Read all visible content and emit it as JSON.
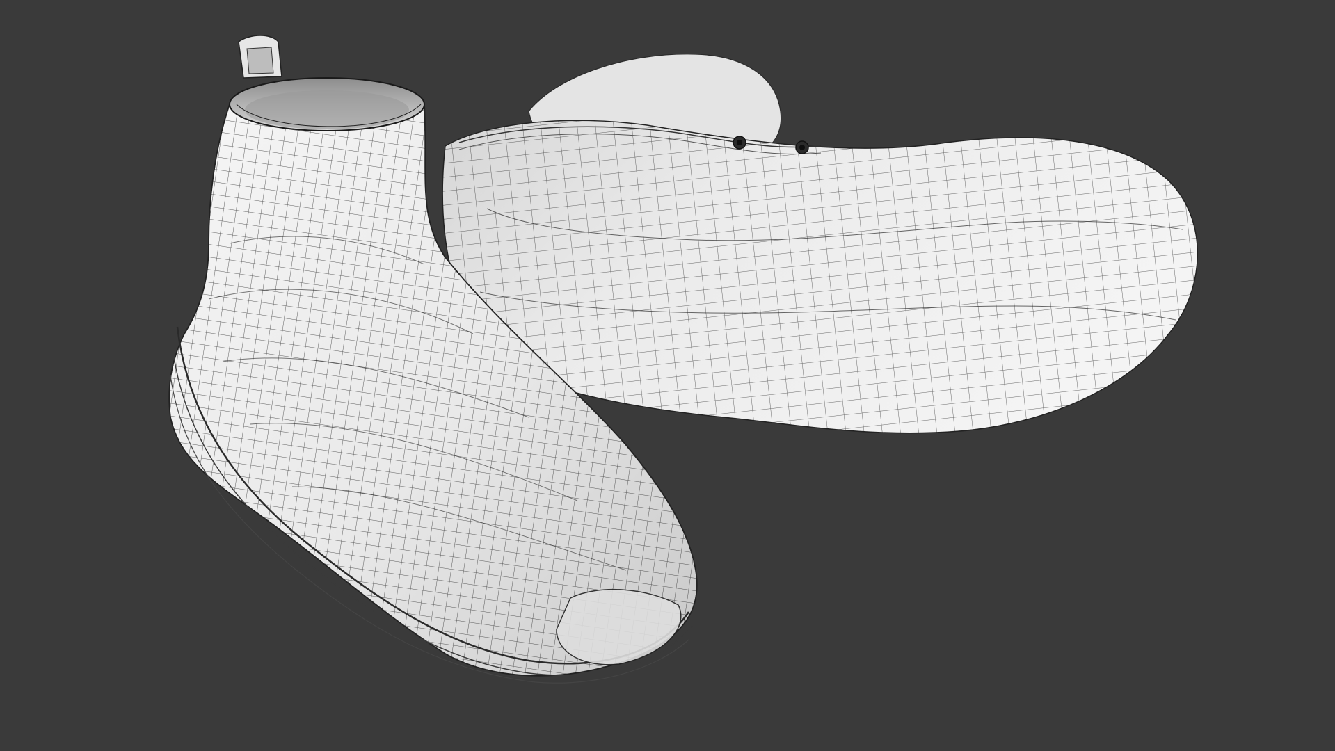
{
  "scene": {
    "background_color": "#3a3a3a",
    "model_color": "#ececec",
    "model_shadow_color": "#c9c9c9",
    "wire_color": "#1c1c1c",
    "objects": [
      {
        "name": "boot-front",
        "view": "side",
        "description_icon": "boot-icon"
      },
      {
        "name": "boot-back",
        "view": "sole",
        "description_icon": "sole-icon"
      }
    ]
  }
}
